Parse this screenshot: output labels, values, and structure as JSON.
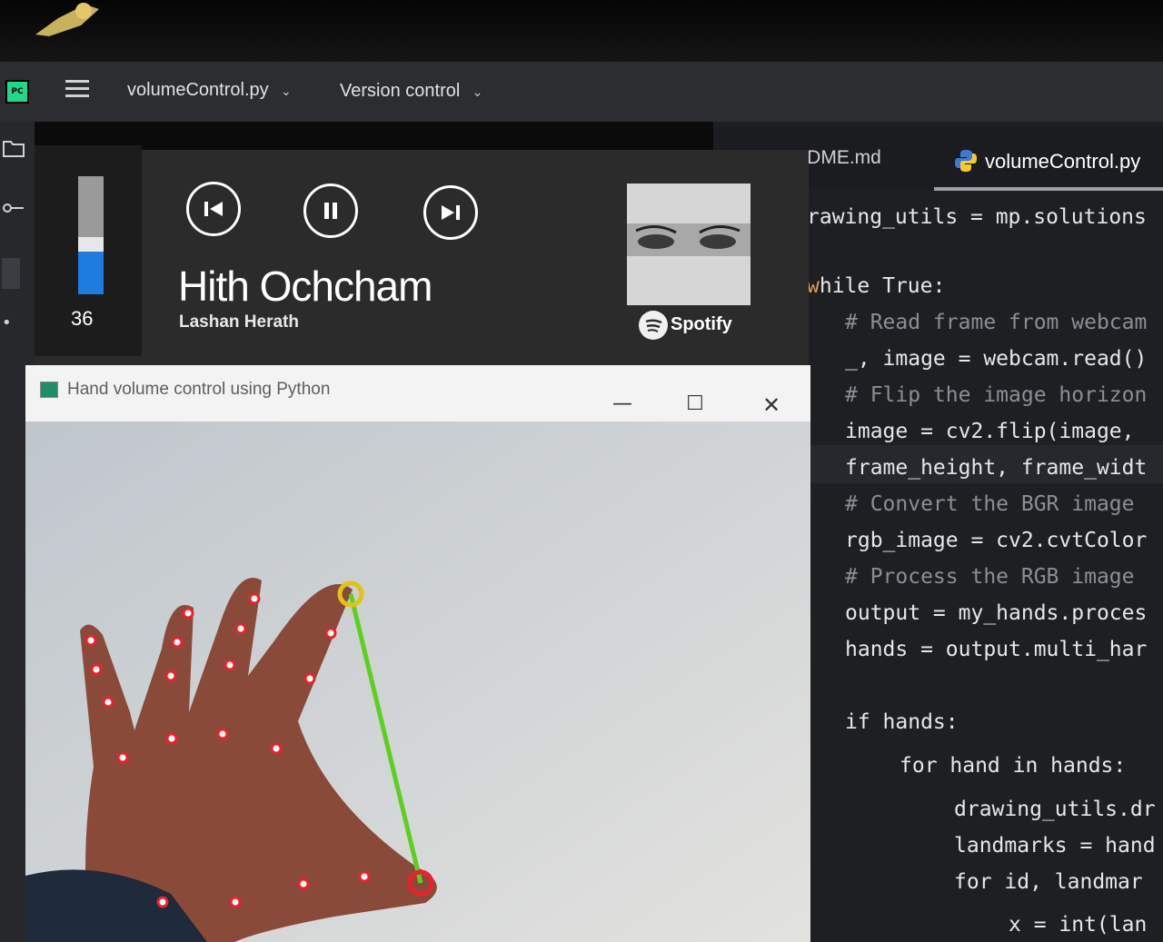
{
  "toolbar": {
    "file_name": "volumeControl.py",
    "version_control": "Version control"
  },
  "editor": {
    "tabs": [
      {
        "label": "README.md"
      },
      {
        "label": "volumeControl.py",
        "active": true
      }
    ],
    "code_lines": [
      "rawing_utils = mp.solutions",
      "hile True:",
      "# Read frame from webcam",
      "_, image = webcam.read()",
      "# Flip the image horizon",
      "image = cv2.flip(image,",
      "frame_height, frame_widt",
      "# Convert the BGR image",
      "rgb_image = cv2.cvtColor",
      "# Process the RGB image",
      "output = my_hands.proces",
      "hands = output.multi_har",
      "if hands:",
      "for hand in hands:",
      "drawing_utils.dr",
      "landmarks = hand",
      "for id, landmar",
      "x = int(lan"
    ]
  },
  "media": {
    "volume": 36,
    "volume_label": "36",
    "song_title": "Hith Ochcham",
    "artist": "Lashan Herath",
    "source": "Spotify",
    "controls": [
      "previous-track",
      "pause",
      "next-track"
    ]
  },
  "camera_window": {
    "title": "Hand volume control using Python",
    "minimize": "—",
    "maximize": "☐",
    "close": "✕"
  },
  "colors": {
    "ide_bg": "#1e1f22",
    "keyword": "#e39a5b",
    "comment": "#8b8e94",
    "volume_fill": "#1e7be0",
    "landmark": "#e8222b",
    "distance_line": "#5bd11e",
    "fingertip_highlight": "#e0c313"
  }
}
